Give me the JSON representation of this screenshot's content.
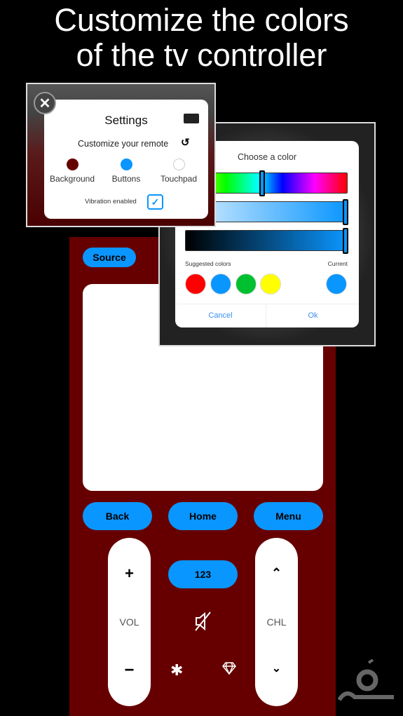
{
  "headline": {
    "line1": "Customize the colors",
    "line2": "of the tv controller"
  },
  "colors": {
    "background": "#660000",
    "buttons": "#0a96ff",
    "touchpad": "#ffffff"
  },
  "remote": {
    "source": "Source",
    "back": "Back",
    "home": "Home",
    "menu": "Menu",
    "num": "123",
    "vol": "VOL",
    "chl": "CHL",
    "vol_up": "+",
    "vol_down": "−"
  },
  "settings": {
    "title": "Settings",
    "subtitle": "Customize your remote",
    "swatches": [
      {
        "label": "Background"
      },
      {
        "label": "Buttons"
      },
      {
        "label": "Touchpad"
      }
    ],
    "vibration_label": "Vibration enabled",
    "vibration_enabled": true
  },
  "picker": {
    "title": "Choose a color",
    "hue_position": 0.47,
    "saturation_position": 1.0,
    "brightness_position": 1.0,
    "suggested_label": "Suggested colors",
    "current_label": "Current",
    "suggested": [
      "#ff0000",
      "#0a96ff",
      "#00c030",
      "#ffff00"
    ],
    "current": "#0a96ff",
    "cancel": "Cancel",
    "ok": "Ok"
  }
}
